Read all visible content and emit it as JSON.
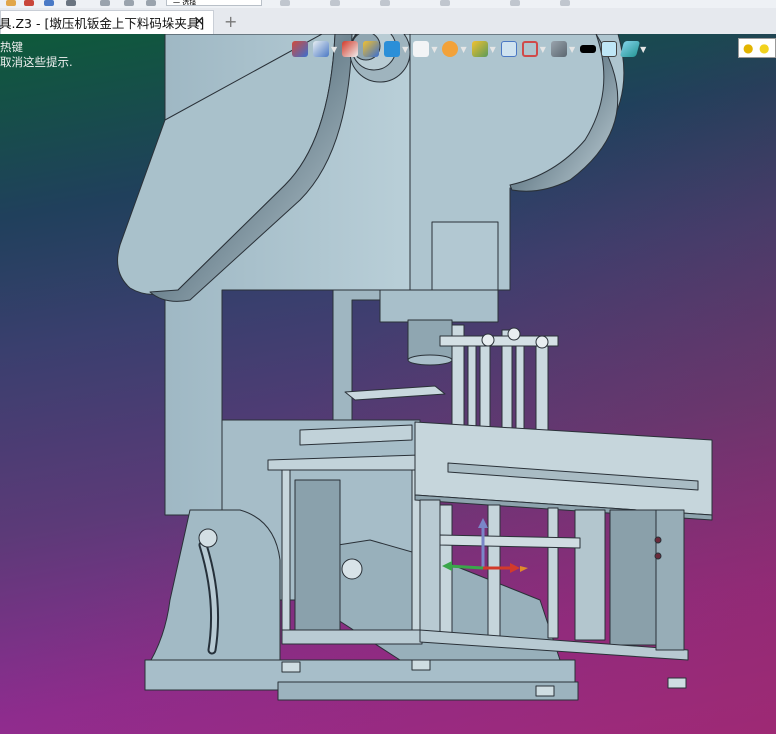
{
  "toolbar": {
    "select_value": "一 选择",
    "icons": [
      "new-file-icon",
      "open-icon",
      "save-icon",
      "print-icon",
      "undo-icon",
      "redo-icon",
      "search-icon"
    ]
  },
  "tabs": [
    {
      "title": "具.Z3 - [墩压机钣金上下料码垛夹具]",
      "close": "✕",
      "active": true
    }
  ],
  "tab_add": "+",
  "viewport": {
    "hint_lines": [
      "热键",
      "取消这些提示."
    ],
    "toolbar_icons": [
      "rotate-view-icon",
      "view-dir-icon",
      "pen-icon",
      "shade-icon",
      "box-view-icon",
      "cube-view-icon",
      "section-icon",
      "filter-icon",
      "zoom-fit-icon",
      "dimension-icon",
      "render-mode-icon",
      "color-swatch-black-icon",
      "color-swatch-cyan-icon",
      "layer-icon",
      "lightbulb-icon"
    ]
  }
}
